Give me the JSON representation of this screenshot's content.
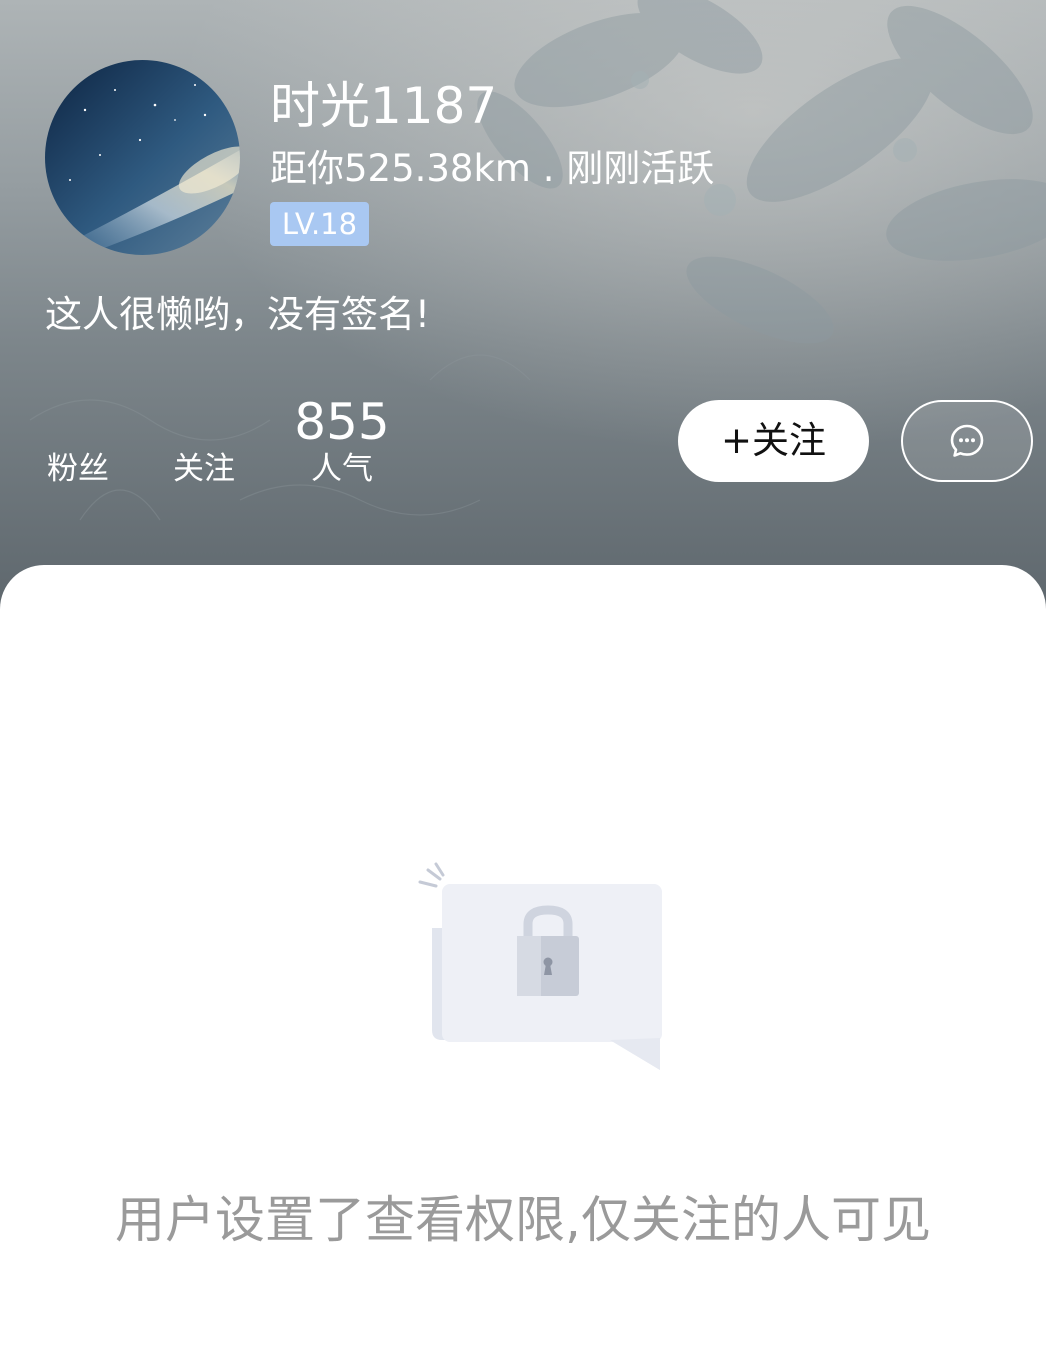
{
  "profile": {
    "username": "时光1187",
    "distance_status": "距你525.38km . 刚刚活跃",
    "level": "LV.18",
    "signature": "这人很懒哟，没有签名!",
    "avatar_icon": "galaxy-avatar"
  },
  "stats": {
    "fans": {
      "label": "粉丝",
      "value": ""
    },
    "following": {
      "label": "关注",
      "value": ""
    },
    "popularity": {
      "label": "人气",
      "value": "855"
    }
  },
  "actions": {
    "follow_label": "+关注",
    "message_icon": "chat-bubble-icon"
  },
  "empty_state": {
    "icon": "lock-icon",
    "message": "用户设置了查看权限,仅关注的人可见"
  },
  "colors": {
    "level_badge": "#a9c8f2",
    "notice_text": "#9a9a9a",
    "follow_button_bg": "#ffffff"
  }
}
